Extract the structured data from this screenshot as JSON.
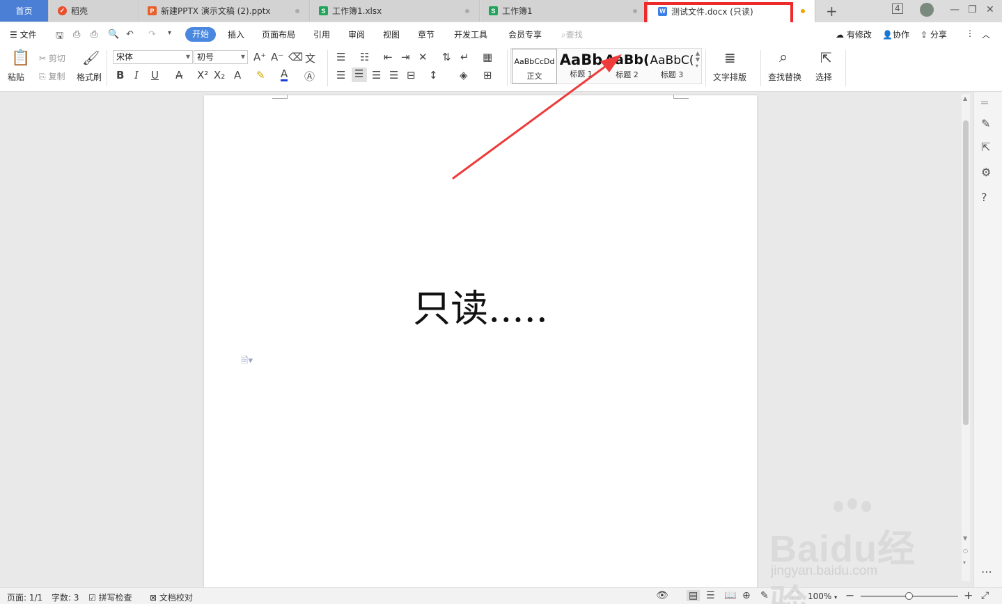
{
  "tabs": [
    {
      "label": "首页",
      "kind": "home"
    },
    {
      "label": "稻壳",
      "kind": "docer",
      "color": "#e94f2b"
    },
    {
      "label": "新建PPTX 演示文稿 (2).pptx",
      "kind": "ppt",
      "color": "#e8602c",
      "icon_letter": "P"
    },
    {
      "label": "工作簿1.xlsx",
      "kind": "xls",
      "color": "#22a55b",
      "icon_letter": "S"
    },
    {
      "label": "工作簿1",
      "kind": "xls",
      "color": "#22a55b",
      "icon_letter": "S"
    },
    {
      "label": "测试文件.docx (只读)",
      "kind": "doc",
      "color": "#3c7ee8",
      "icon_letter": "W",
      "active": true
    }
  ],
  "window": {
    "tab_count": "4"
  },
  "menu": {
    "file": "文件",
    "items": [
      "开始",
      "插入",
      "页面布局",
      "引用",
      "审阅",
      "视图",
      "章节",
      "开发工具",
      "会员专享"
    ],
    "search": "查找",
    "right": {
      "modified": "有修改",
      "collab": "协作",
      "share": "分享"
    }
  },
  "ribbon": {
    "paste": "粘贴",
    "cut": "剪切",
    "copy": "复制",
    "format_painter": "格式刷",
    "font_name": "宋体",
    "font_size": "初号",
    "styles": [
      {
        "preview": "AaBbCcDd",
        "label": "正文"
      },
      {
        "preview": "AaBb",
        "label": "标题 1"
      },
      {
        "preview": "AaBb(",
        "label": "标题 2"
      },
      {
        "preview": "AaBbC(",
        "label": "标题 3"
      }
    ],
    "text_layout": "文字排版",
    "find_replace": "查找替换",
    "select": "选择"
  },
  "document": {
    "body_text": "只读....."
  },
  "status": {
    "page": "页面: 1/1",
    "words": "字数: 3",
    "spell": "拼写检查",
    "proof": "文档校对",
    "zoom": "100%"
  },
  "watermark": {
    "main": "Baidu经验",
    "sub": "jingyan.baidu.com"
  },
  "colors": {
    "accent": "#4a88e0",
    "annotation": "#ee2b2b"
  }
}
